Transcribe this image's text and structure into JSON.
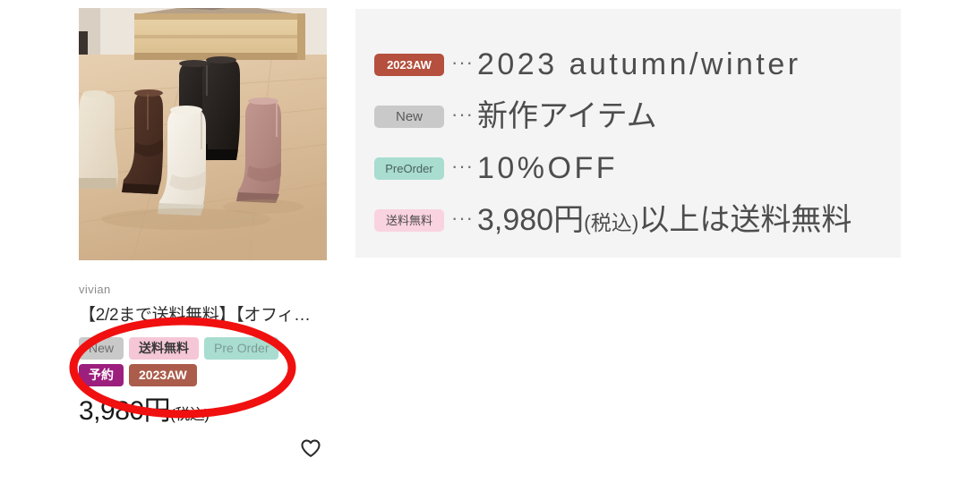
{
  "legend": {
    "rows": [
      {
        "badge": "2023AW",
        "badge_color": "#b4503d",
        "badge_text_color": "#ffffff",
        "dots": "···",
        "description": "2023 autumn/winter",
        "script": "latin"
      },
      {
        "badge": "New",
        "badge_color": "#c9c9c9",
        "badge_text_color": "#5b5b5b",
        "dots": "···",
        "description": "新作アイテム",
        "script": "jp"
      },
      {
        "badge": "PreOrder",
        "badge_color": "#a8ddd0",
        "badge_text_color": "#4b5f5c",
        "dots": "···",
        "description": "10%OFF",
        "script": "latin"
      },
      {
        "badge": "送料無料",
        "badge_color": "#fad3e0",
        "badge_text_color": "#4a4a4a",
        "dots": "···",
        "description_main": "3,980円",
        "description_small": "(税込)",
        "description_tail": "以上は送料無料",
        "script": "jp"
      }
    ],
    "panel_background": "#f4f4f4"
  },
  "product_card": {
    "brand": "vivian",
    "title": "【2/2まで送料無料】【オフィ…",
    "tags": [
      {
        "label": "New",
        "background": "#c9c9c9",
        "text_color": "#6d6d6d"
      },
      {
        "label": "送料無料",
        "background": "#f5c7d6",
        "text_color": "#3a3a3a"
      },
      {
        "label": "Pre Order",
        "background": "#a8ddd0",
        "text_color": "#7d9b95"
      },
      {
        "label": "予約",
        "background": "#9c1f7e",
        "text_color": "#ffffff"
      },
      {
        "label": "2023AW",
        "background": "#ab5c4b",
        "text_color": "#ffffff"
      }
    ],
    "price_main": "3,980円",
    "price_tax": "(税込)",
    "favorite_icon": "heart-outline-icon"
  },
  "annotation": {
    "shape": "ellipse",
    "color": "#f01010",
    "stroke_width": 9,
    "target": "product-card-tags"
  },
  "photo": {
    "alt": "five ankle boots on wooden floor",
    "icon": "product-photo"
  }
}
